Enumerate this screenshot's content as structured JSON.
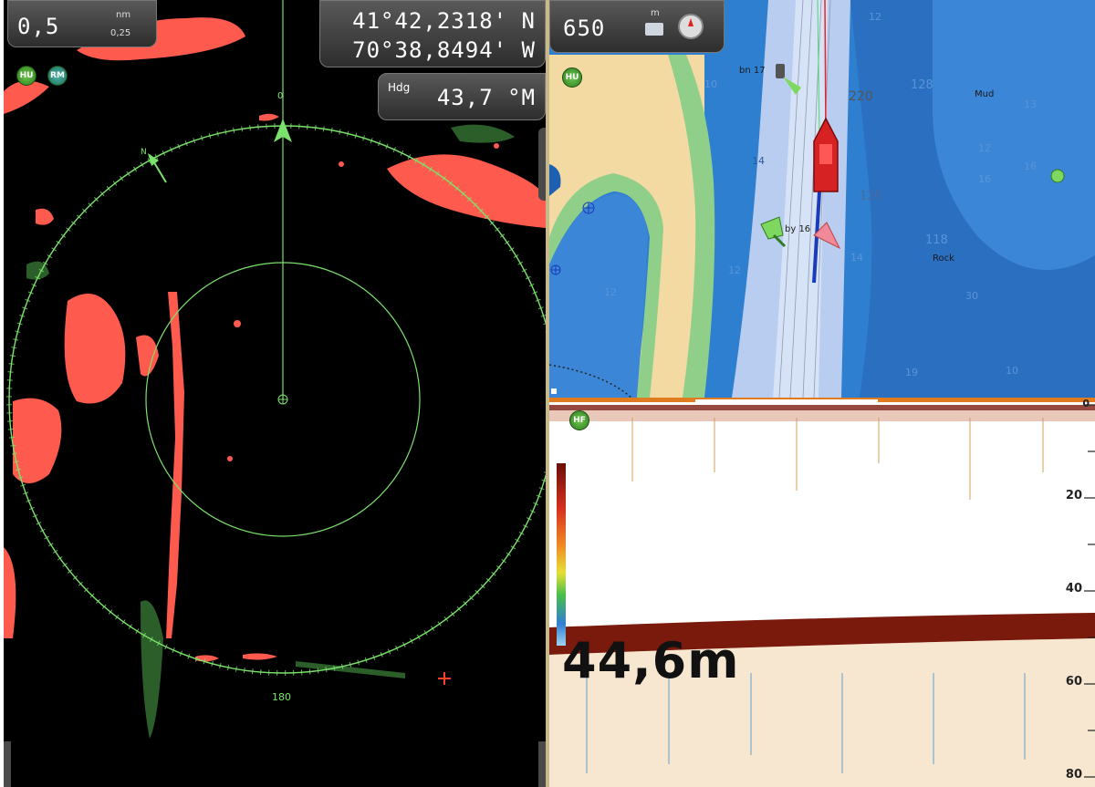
{
  "radar": {
    "range_value": "0,5",
    "range_unit": "nm",
    "ring_value": "0,25",
    "badge_hu": "HU",
    "badge_rm": "RM",
    "bearing_top": "0",
    "bearing_bottom": "180",
    "north_label": "N"
  },
  "position": {
    "lat": "41°42,2318' N",
    "lon": "70°38,8494' W"
  },
  "heading": {
    "label": "Hdg",
    "value": "43,7 °M"
  },
  "chart": {
    "scale_value": "650",
    "scale_unit": "m",
    "badge_hu": "HU",
    "soundings": [
      "12",
      "10",
      "220",
      "128",
      "13",
      "14",
      "12",
      "120",
      "118",
      "16",
      "16",
      "14",
      "12",
      "12",
      "30",
      "19",
      "10"
    ],
    "labels": {
      "buoy_17": "bn 17",
      "buoy_16": "by 16",
      "mud": "Mud",
      "rock": "Rock"
    }
  },
  "sonar": {
    "badge_hf": "HF",
    "depth_reading": "44,6m",
    "depth_scale": [
      "0",
      "20",
      "40",
      "60",
      "80"
    ]
  },
  "colors": {
    "radar_echo": "#ff5a4e",
    "radar_ring": "#7be36b",
    "chart_deep": "#2f7fd1",
    "chart_shallow": "#b8cdef",
    "chart_land": "#f3d9a2",
    "sonar_bottom": "#7a1a0c"
  }
}
